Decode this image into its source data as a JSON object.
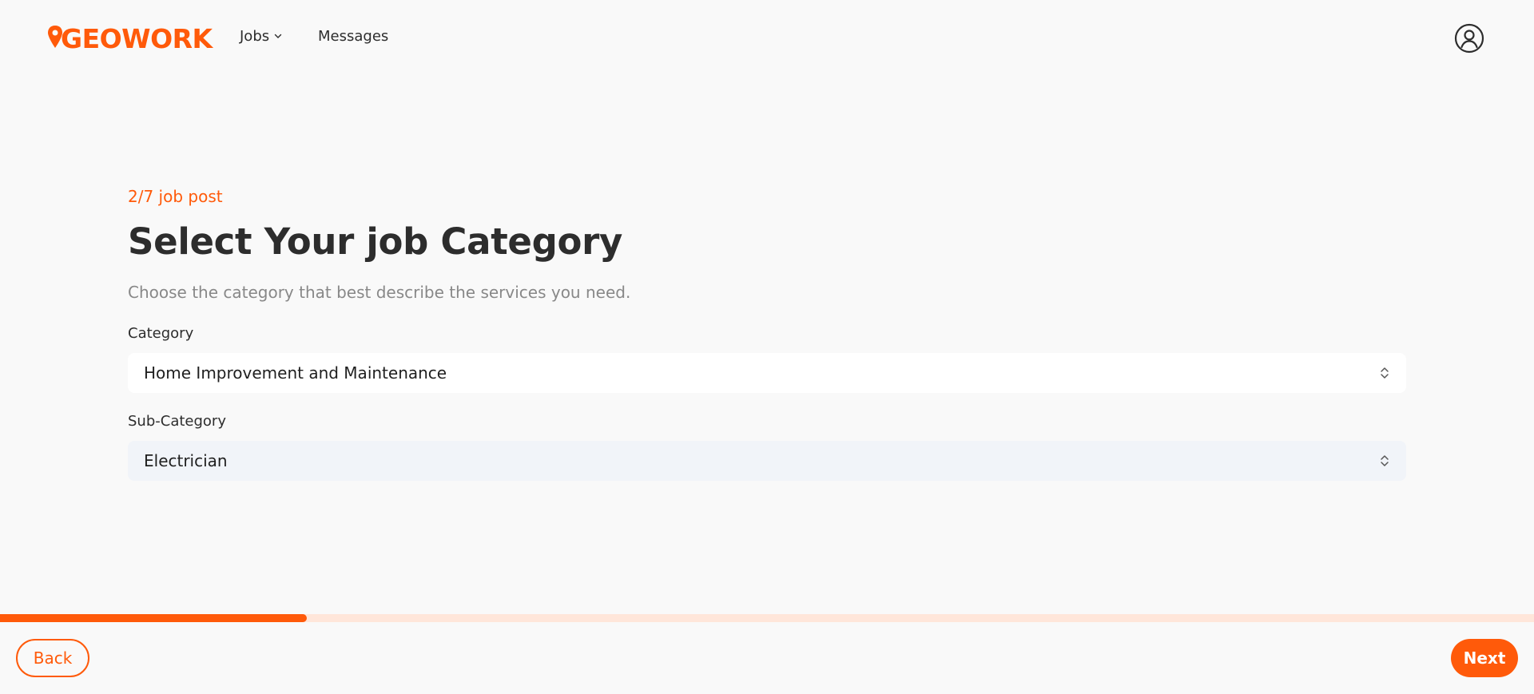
{
  "header": {
    "logo_text": "GEOWORK",
    "nav": {
      "jobs_label": "Jobs",
      "messages_label": "Messages"
    },
    "icons": {
      "jobs_chevron": "chevron-down-icon",
      "profile": "user-circle-icon"
    }
  },
  "form": {
    "step_label": "2/7 job post",
    "title": "Select Your job Category",
    "subtitle": "Choose the category that best describe the services you need.",
    "category": {
      "label": "Category",
      "value": "Home Improvement and Maintenance"
    },
    "sub_category": {
      "label": "Sub-Category",
      "value": "Electrician"
    }
  },
  "footer": {
    "progress_fraction": 0.2,
    "back_label": "Back",
    "next_label": "Next"
  },
  "colors": {
    "accent": "#ff5a0a",
    "progress_track": "#ffe6da",
    "background": "#f9f9f9",
    "text": "#2d2d2d",
    "muted": "#888888"
  }
}
